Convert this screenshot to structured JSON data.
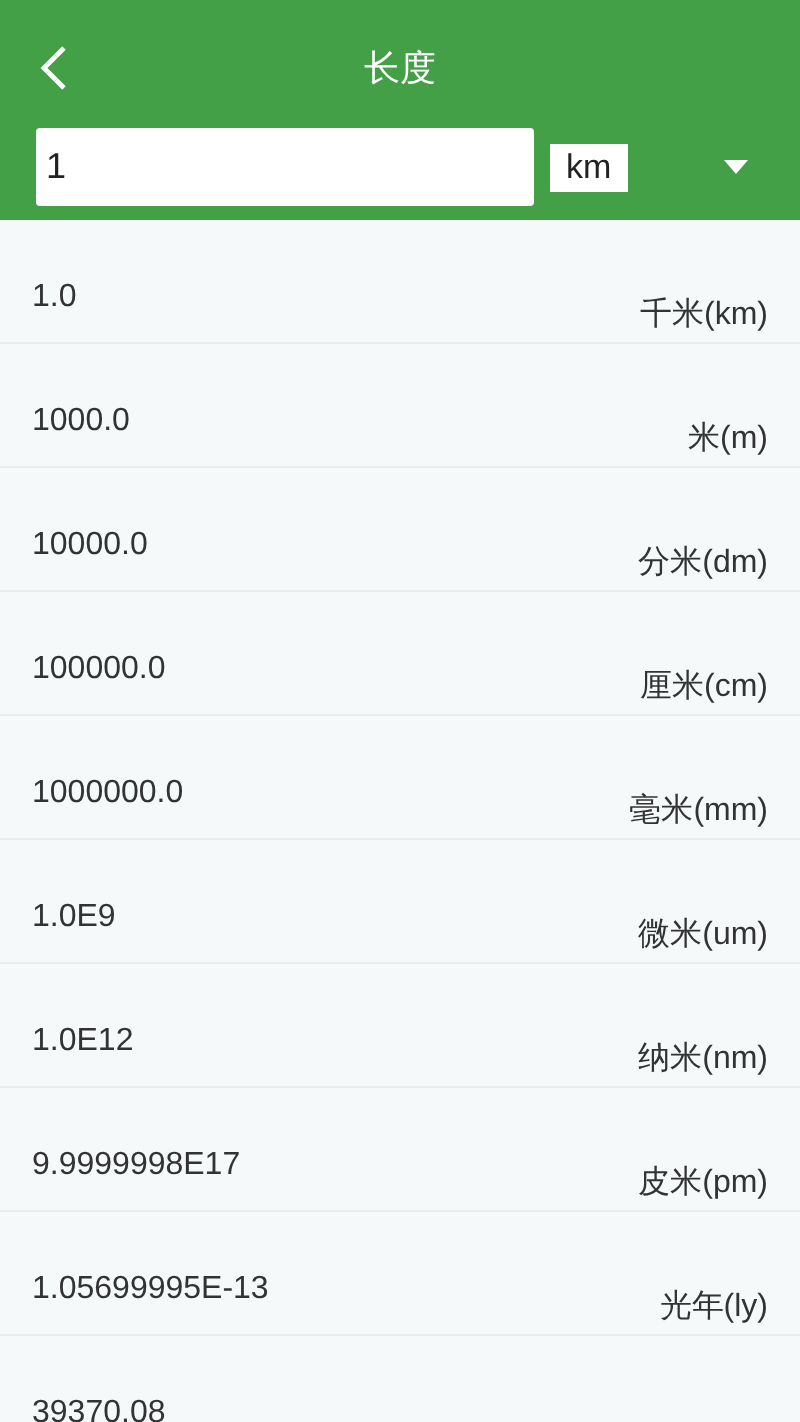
{
  "header": {
    "title": "长度"
  },
  "input": {
    "value": "1",
    "unit": "km"
  },
  "rows": [
    {
      "value": "1.0",
      "unit": "千米(km)"
    },
    {
      "value": "1000.0",
      "unit": "米(m)"
    },
    {
      "value": "10000.0",
      "unit": "分米(dm)"
    },
    {
      "value": "100000.0",
      "unit": "厘米(cm)"
    },
    {
      "value": "1000000.0",
      "unit": "毫米(mm)"
    },
    {
      "value": "1.0E9",
      "unit": "微米(um)"
    },
    {
      "value": "1.0E12",
      "unit": "纳米(nm)"
    },
    {
      "value": "9.9999998E17",
      "unit": "皮米(pm)"
    },
    {
      "value": "1.05699995E-13",
      "unit": "光年(ly)"
    },
    {
      "value": "39370.08"
    }
  ]
}
